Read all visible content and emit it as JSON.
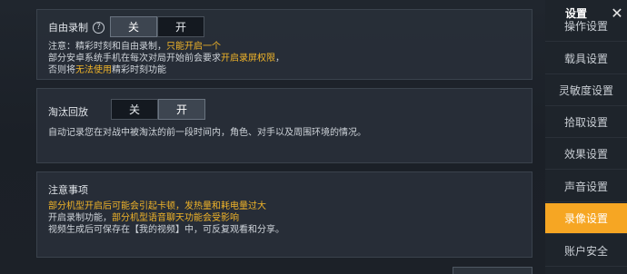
{
  "free_record": {
    "label": "自由录制",
    "help_icon": "?",
    "toggle": {
      "off_label": "关",
      "on_label": "开",
      "selected": "off"
    },
    "notes": [
      [
        {
          "t": "注意：精彩时刻和自由录制，"
        },
        {
          "t": "只能开启一个",
          "hl": true
        }
      ],
      [
        {
          "t": "部分安卓系统手机在每次对局开始前会要求"
        },
        {
          "t": "开启录屏权限",
          "hl": true
        },
        {
          "t": "，"
        }
      ],
      [
        {
          "t": "否则将"
        },
        {
          "t": "无法使用",
          "hl": true
        },
        {
          "t": "精彩时刻功能"
        }
      ]
    ]
  },
  "elimination_replay": {
    "label": "淘汰回放",
    "toggle": {
      "off_label": "关",
      "on_label": "开",
      "selected": "on"
    },
    "description": "自动记录您在对战中被淘汰的前一段时间内，角色、对手以及周围环境的情况。"
  },
  "notice": {
    "title": "注意事项",
    "lines": [
      [
        {
          "t": "部分机型开启后可能会引起卡顿，发热量和耗电量过大",
          "hl": true
        }
      ],
      [
        {
          "t": "开启录制功能，"
        },
        {
          "t": "部分机型语音聊天功能会受影响",
          "hl": true
        }
      ],
      [
        {
          "t": "视频生成后可保存在【我的视频】中，可反复观看和分享。"
        }
      ]
    ]
  },
  "sidebar": {
    "title": "设置",
    "close_icon": "✕",
    "items": [
      {
        "label": "操作设置",
        "active": false
      },
      {
        "label": "载具设置",
        "active": false
      },
      {
        "label": "灵敏度设置",
        "active": false
      },
      {
        "label": "拾取设置",
        "active": false
      },
      {
        "label": "效果设置",
        "active": false
      },
      {
        "label": "声音设置",
        "active": false
      },
      {
        "label": "录像设置",
        "active": true
      },
      {
        "label": "账户安全",
        "active": false
      }
    ]
  },
  "colors": {
    "accent": "#f6a623",
    "highlight": "#f0b429"
  }
}
